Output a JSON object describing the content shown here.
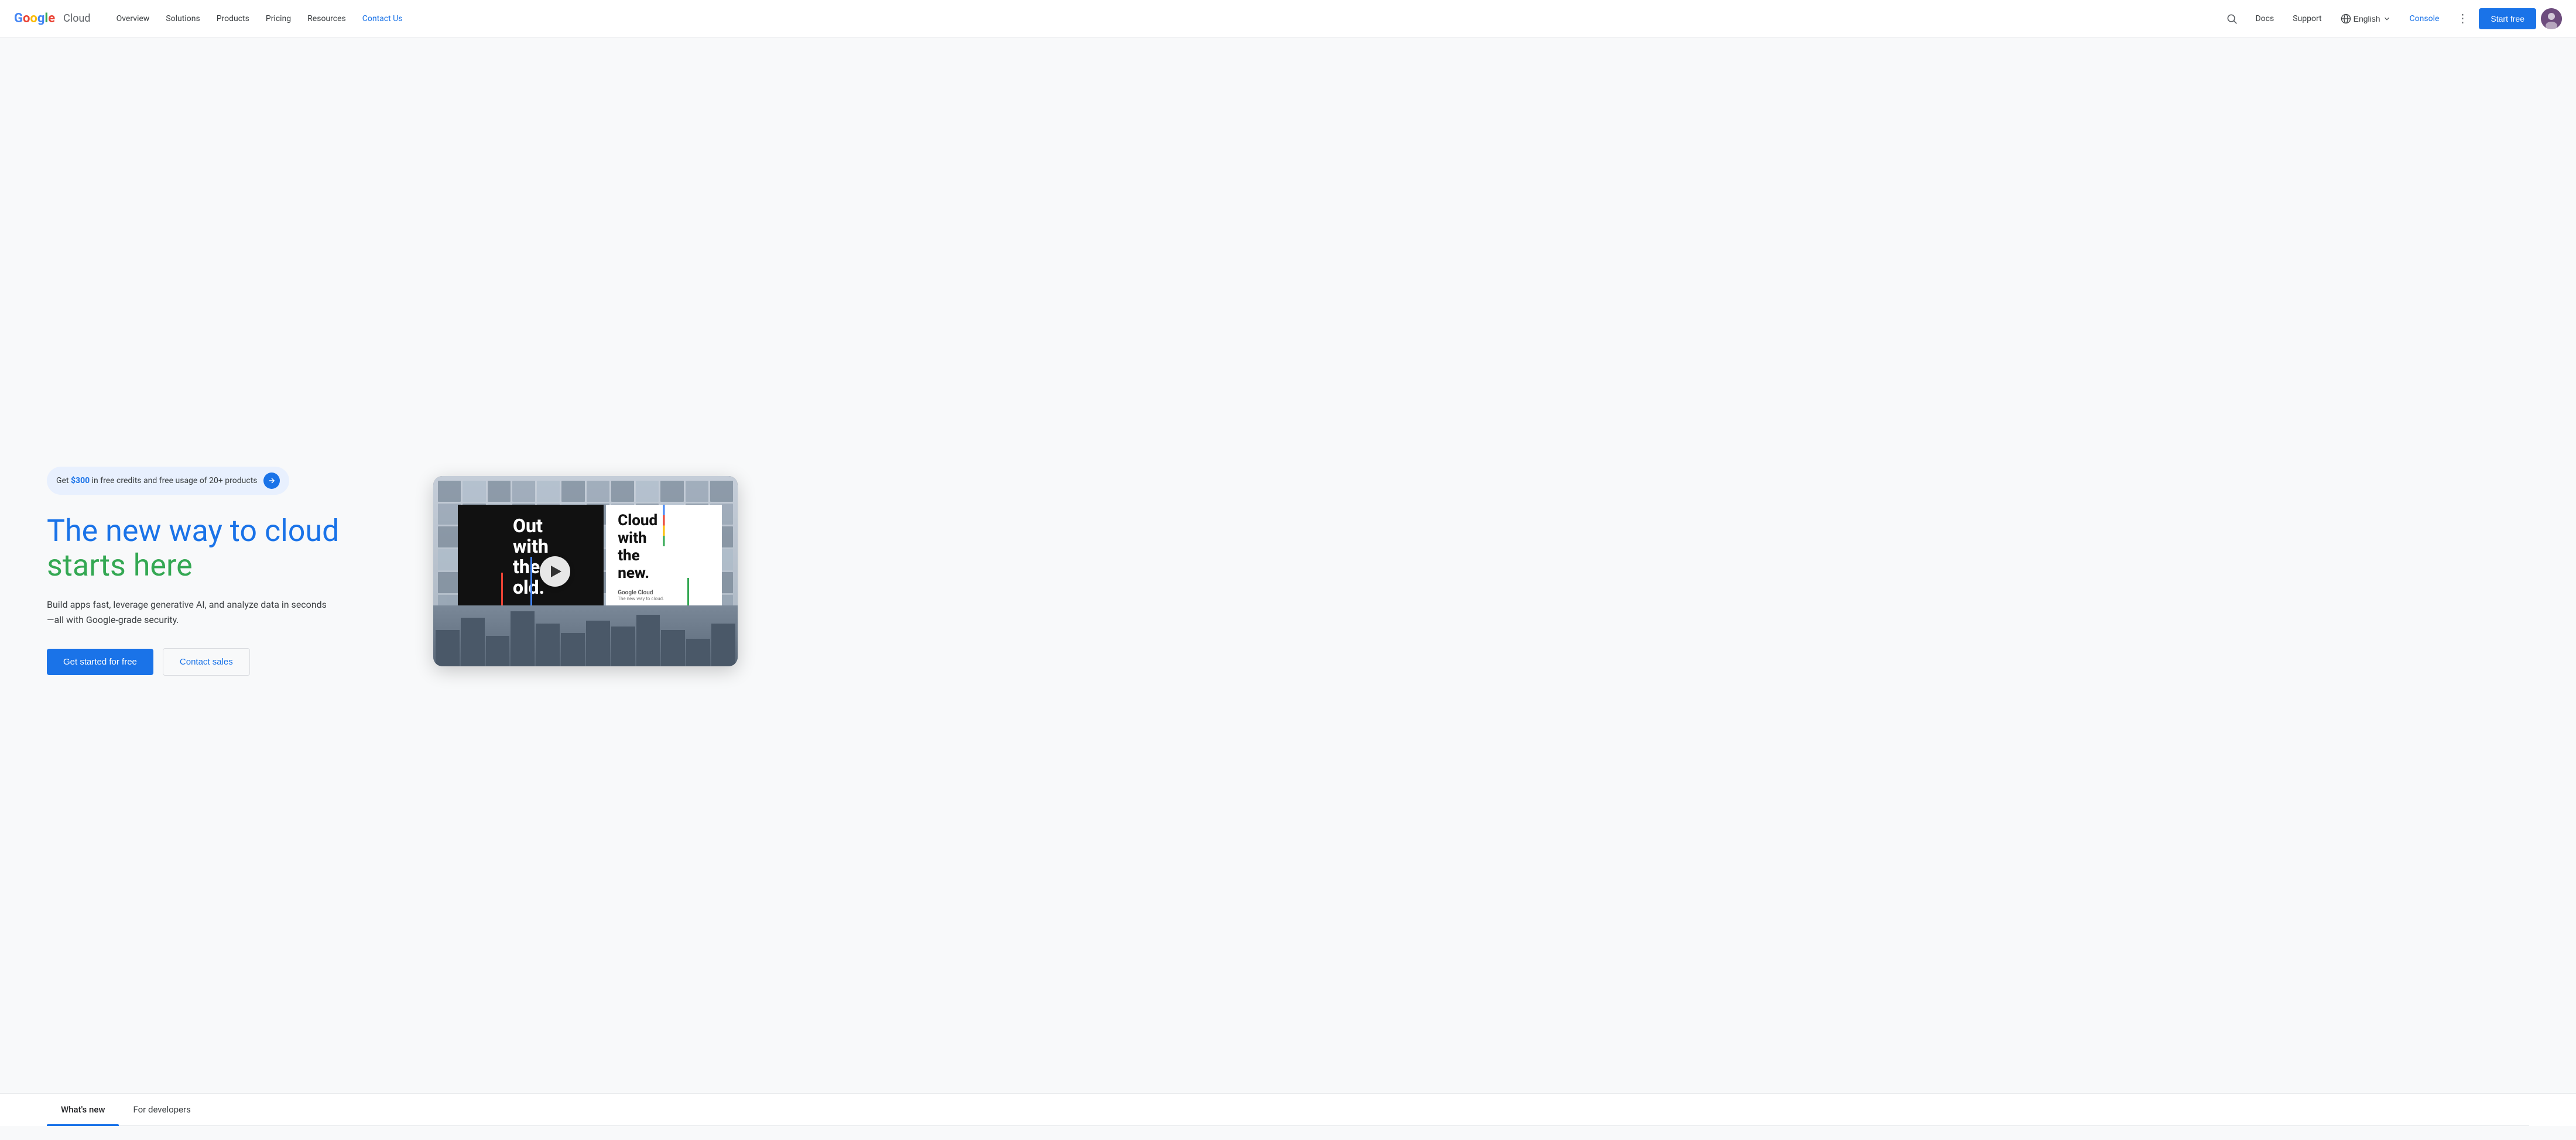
{
  "meta": {
    "title": "Google Cloud: Cloud Computing Services"
  },
  "navbar": {
    "logo": {
      "google": "Google",
      "cloud": "Cloud"
    },
    "links": [
      {
        "id": "overview",
        "label": "Overview"
      },
      {
        "id": "solutions",
        "label": "Solutions"
      },
      {
        "id": "products",
        "label": "Products"
      },
      {
        "id": "pricing",
        "label": "Pricing"
      },
      {
        "id": "resources",
        "label": "Resources"
      },
      {
        "id": "contact-us",
        "label": "Contact Us",
        "active": true
      }
    ],
    "right": {
      "docs": "Docs",
      "support": "Support",
      "language": "English",
      "console": "Console",
      "start_free": "Start free"
    }
  },
  "hero": {
    "promo": {
      "prefix": "Get ",
      "amount": "$300",
      "suffix": " in free credits and free usage of 20+ products"
    },
    "title_line1": "The new way to cloud",
    "title_line2": "starts here",
    "subtitle": "Build apps fast, leverage generative AI, and analyze data in seconds—all with Google-grade security.",
    "cta_primary": "Get started for free",
    "cta_secondary": "Contact sales"
  },
  "video": {
    "billboard_left_text": "Out\nwith\nthe\nold.",
    "billboard_right_text": "Cloud\nwith\nthe\nnew.",
    "brand_name": "Google Cloud",
    "tagline": "The new way to cloud."
  },
  "tabs": [
    {
      "id": "whats-new",
      "label": "What's new",
      "active": true
    },
    {
      "id": "for-developers",
      "label": "For developers",
      "active": false
    }
  ],
  "colors": {
    "google_blue": "#4285F4",
    "google_red": "#EA4335",
    "google_yellow": "#FBBC05",
    "google_green": "#34A853",
    "brand_blue": "#1a73e8",
    "text_dark": "#202124",
    "text_medium": "#3c4043",
    "text_light": "#5f6368",
    "bg_light": "#f8f9fa",
    "border": "#e8eaed"
  }
}
